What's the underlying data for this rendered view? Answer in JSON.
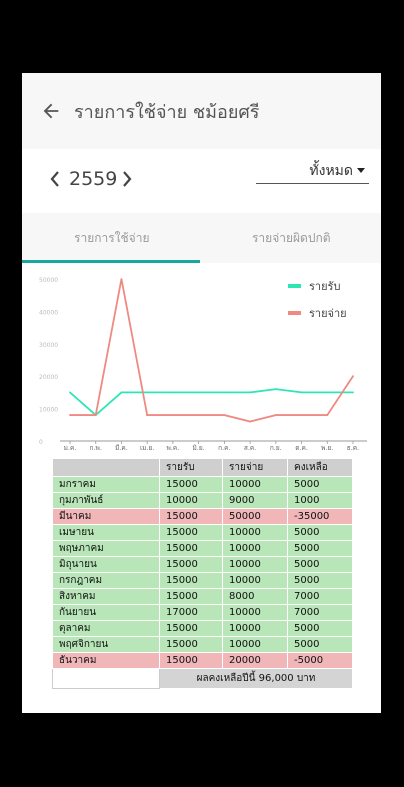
{
  "header": {
    "title": "รายการใช้จ่าย ชม้อยศรี"
  },
  "year": {
    "value": "2559"
  },
  "filter": {
    "value": "ทั้งหมด"
  },
  "tabs": [
    {
      "label": "รายการใช้จ่าย",
      "active": true
    },
    {
      "label": "รายจ่ายผิดปกติ",
      "active": false
    }
  ],
  "chart_data": {
    "type": "line",
    "categories": [
      "ม.ค.",
      "ก.พ.",
      "มี.ค.",
      "เม.ย.",
      "พ.ค.",
      "มิ.ย.",
      "ก.ค.",
      "ส.ค.",
      "ก.ย.",
      "ต.ค.",
      "พ.ย.",
      "ธ.ค."
    ],
    "series": [
      {
        "name": "รายรับ",
        "color": "#2ee6b4",
        "values": [
          15000,
          8000,
          15000,
          15000,
          15000,
          15000,
          15000,
          15000,
          16000,
          15000,
          15000,
          15000
        ]
      },
      {
        "name": "รายจ่าย",
        "color": "#ef8a82",
        "values": [
          8000,
          8000,
          50000,
          8000,
          8000,
          8000,
          8000,
          6000,
          8000,
          8000,
          8000,
          20000
        ]
      }
    ],
    "yticks": [
      "0",
      "10000",
      "20000",
      "30000",
      "40000",
      "50000"
    ],
    "ylim": [
      0,
      50000
    ],
    "legend_position": "top-right",
    "grid": false
  },
  "table": {
    "headers": [
      "",
      "รายรับ",
      "รายจ่าย",
      "คงเหลือ"
    ],
    "rows": [
      {
        "month": "มกราคม",
        "income": "15000",
        "expense": "10000",
        "balance": "5000",
        "negative": false
      },
      {
        "month": "กุมภาพันธ์",
        "income": "10000",
        "expense": "9000",
        "balance": "1000",
        "negative": false
      },
      {
        "month": "มีนาคม",
        "income": "15000",
        "expense": "50000",
        "balance": "-35000",
        "negative": true
      },
      {
        "month": "เมษายน",
        "income": "15000",
        "expense": "10000",
        "balance": "5000",
        "negative": false
      },
      {
        "month": "พฤษภาคม",
        "income": "15000",
        "expense": "10000",
        "balance": "5000",
        "negative": false
      },
      {
        "month": "มิถุนายน",
        "income": "15000",
        "expense": "10000",
        "balance": "5000",
        "negative": false
      },
      {
        "month": "กรกฎาคม",
        "income": "15000",
        "expense": "10000",
        "balance": "5000",
        "negative": false
      },
      {
        "month": "สิงหาคม",
        "income": "15000",
        "expense": "8000",
        "balance": "7000",
        "negative": false
      },
      {
        "month": "กันยายน",
        "income": "17000",
        "expense": "10000",
        "balance": "7000",
        "negative": false
      },
      {
        "month": "ตุลาคม",
        "income": "15000",
        "expense": "10000",
        "balance": "5000",
        "negative": false
      },
      {
        "month": "พฤศจิกายน",
        "income": "15000",
        "expense": "10000",
        "balance": "5000",
        "negative": false
      },
      {
        "month": "ธันวาคม",
        "income": "15000",
        "expense": "20000",
        "balance": "-5000",
        "negative": true
      }
    ],
    "footer": "ผลคงเหลือปีนี้ 96,000 บาท"
  }
}
